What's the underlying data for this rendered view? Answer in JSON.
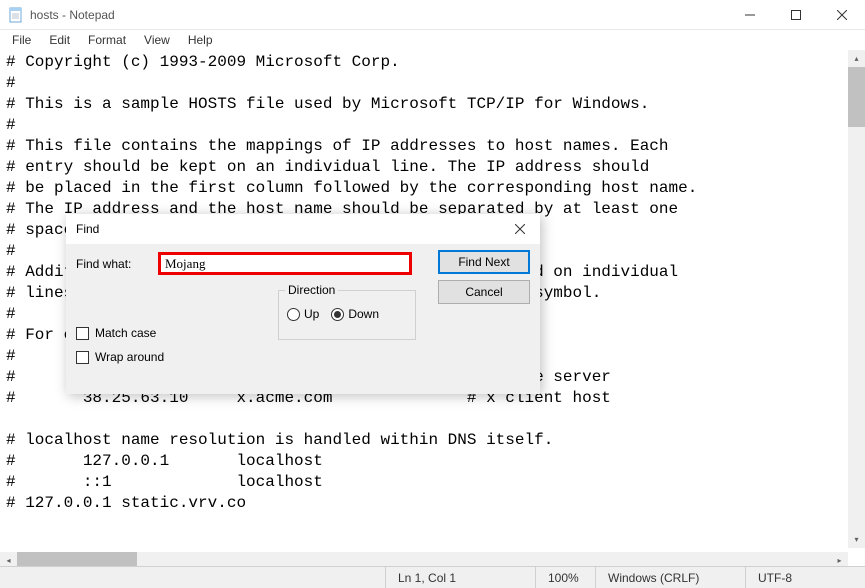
{
  "window": {
    "title": "hosts - Notepad"
  },
  "menu": [
    "File",
    "Edit",
    "Format",
    "View",
    "Help"
  ],
  "text": "# Copyright (c) 1993-2009 Microsoft Corp.\n#\n# This is a sample HOSTS file used by Microsoft TCP/IP for Windows.\n#\n# This file contains the mappings of IP addresses to host names. Each\n# entry should be kept on an individual line. The IP address should\n# be placed in the first column followed by the corresponding host name.\n# The IP address and the host name should be separated by at least one\n# space.\n#\n# Additionally, comments (such as these) may be inserted on individual\n# lines or following the machine name denoted by a '#' symbol.\n#\n# For example:\n#\n#      102.54.94.97     rhino.acme.com          # source server\n#       38.25.63.10     x.acme.com              # x client host\n\n# localhost name resolution is handled within DNS itself.\n#\t127.0.0.1       localhost\n#\t::1             localhost\n# 127.0.0.1 static.vrv.co",
  "find": {
    "title": "Find",
    "what_label": "Find what:",
    "value": "Mojang",
    "find_next": "Find Next",
    "cancel": "Cancel",
    "match_case": "Match case",
    "wrap_around": "Wrap around",
    "direction_label": "Direction",
    "up": "Up",
    "down": "Down"
  },
  "status": {
    "position": "Ln 1, Col 1",
    "zoom": "100%",
    "eol": "Windows (CRLF)",
    "encoding": "UTF-8"
  }
}
